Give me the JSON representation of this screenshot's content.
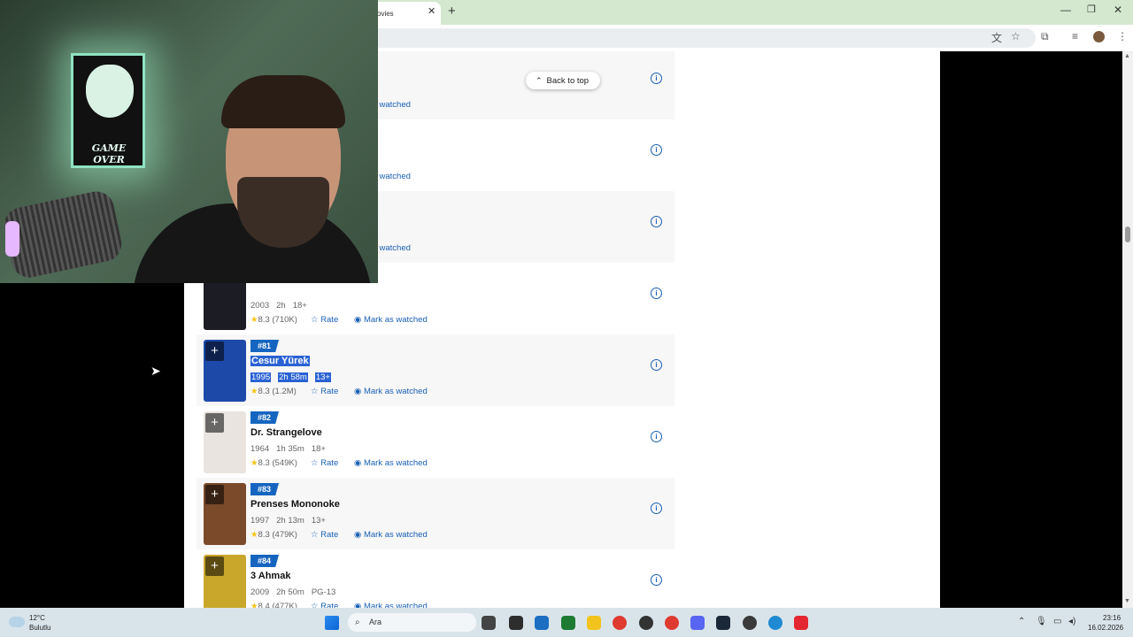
{
  "browser": {
    "tab_title": "ovies",
    "tab_close": "✕",
    "new_tab": "+",
    "minimize": "—",
    "maximize": "❐",
    "close": "✕"
  },
  "page": {
    "back_to_top": "Back to top",
    "back_chevron": "⌃",
    "list": [
      {
        "rank": "",
        "title": "",
        "year": "",
        "duration": "",
        "cert": "",
        "rating": "",
        "votes": "",
        "rate_label": "",
        "watch_label": "ark as watched",
        "shade": true,
        "partial": true
      },
      {
        "rank": "",
        "title": "",
        "year": "",
        "duration": "",
        "cert": "",
        "rating": "",
        "votes": "",
        "rate_label": "",
        "watch_label": "ark as watched",
        "shade": false,
        "partial": true
      },
      {
        "rank": "",
        "title": "",
        "year": "",
        "duration": "",
        "cert": "",
        "rating": "",
        "votes": "",
        "rate_label": "",
        "watch_label": "ark as watched",
        "shade": true,
        "partial": true
      },
      {
        "rank": "",
        "title": "",
        "year": "2003",
        "duration": "2h",
        "cert": "18+",
        "rating": "8.3",
        "votes": "(710K)",
        "rate_label": "Rate",
        "watch_label": "Mark as watched",
        "shade": false,
        "partial": false
      },
      {
        "rank": "#81",
        "title": "Cesur Yürek",
        "year": "1995",
        "duration": "2h 58m",
        "cert": "13+",
        "rating": "8.3",
        "votes": "(1.2M)",
        "rate_label": "Rate",
        "watch_label": "Mark as watched",
        "shade": true,
        "partial": false,
        "selected": true
      },
      {
        "rank": "#82",
        "title": "Dr. Strangelove",
        "year": "1964",
        "duration": "1h 35m",
        "cert": "18+",
        "rating": "8.3",
        "votes": "(549K)",
        "rate_label": "Rate",
        "watch_label": "Mark as watched",
        "shade": false,
        "partial": false
      },
      {
        "rank": "#83",
        "title": "Prenses Mononoke",
        "year": "1997",
        "duration": "2h 13m",
        "cert": "13+",
        "rating": "8.3",
        "votes": "(479K)",
        "rate_label": "Rate",
        "watch_label": "Mark as watched",
        "shade": true,
        "partial": false
      },
      {
        "rank": "#84",
        "title": "3 Ahmak",
        "year": "2009",
        "duration": "2h 50m",
        "cert": "PG-13",
        "rating": "8.4",
        "votes": "(477K)",
        "rate_label": "Rate",
        "watch_label": "Mark as watched",
        "shade": false,
        "partial": false
      }
    ],
    "poster_colors": [
      "#2b2b2b",
      "#2b2b2b",
      "#2b2b2b",
      "#1c1c24",
      "#1d4aa8",
      "#e9e4df",
      "#7a4a2a",
      "#c9a72a"
    ]
  },
  "webcam": {
    "sign_text": "GAME OVER"
  },
  "taskbar": {
    "temperature": "12°C",
    "weather": "Bulutlu",
    "search_placeholder": "Ara",
    "time": "23:16",
    "date": "16.02.2026"
  },
  "colors": {
    "accent": "#1a5fb4",
    "rank_badge": "#1565c0",
    "selection": "#2a62d4",
    "star": "#f5c518"
  }
}
